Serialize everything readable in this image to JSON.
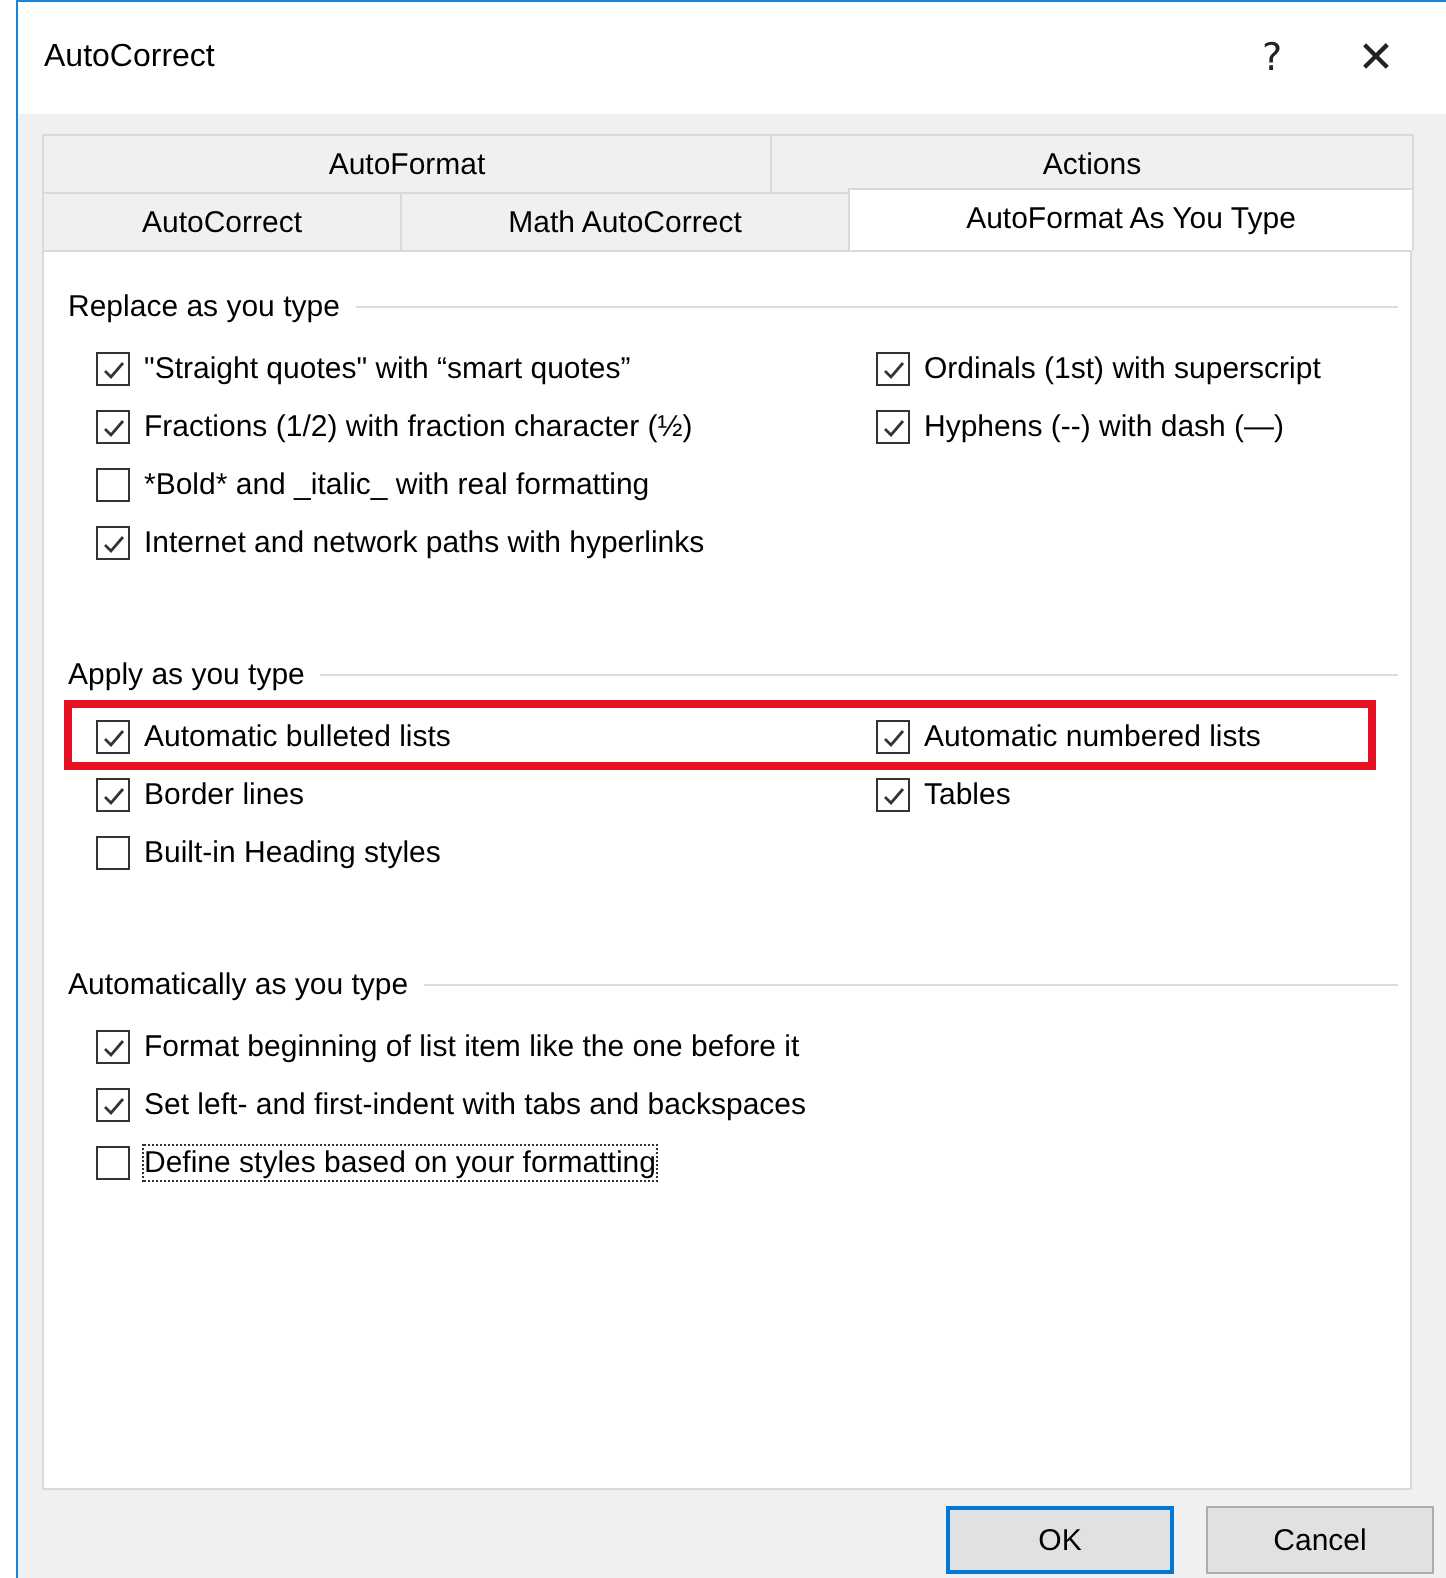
{
  "window": {
    "title": "AutoCorrect",
    "help": "?",
    "close": "✕"
  },
  "tab_rows": [
    [
      {
        "label": "AutoFormat",
        "selected": false
      },
      {
        "label": "Actions",
        "selected": false
      }
    ],
    [
      {
        "label": "AutoCorrect",
        "selected": false
      },
      {
        "label": "Math AutoCorrect",
        "selected": false
      },
      {
        "label": "AutoFormat As You Type",
        "selected": true
      }
    ]
  ],
  "sections": [
    {
      "title": "Replace as you type",
      "rows": [
        {
          "items": [
            {
              "label": "\"Straight quotes\" with “smart quotes”",
              "checked": true
            },
            {
              "label": "Ordinals (1st) with superscript",
              "checked": true
            }
          ]
        },
        {
          "items": [
            {
              "label": "Fractions (1/2) with fraction character (½)",
              "checked": true
            },
            {
              "label": "Hyphens (--) with dash (—)",
              "checked": true
            }
          ]
        },
        {
          "items": [
            {
              "label": "*Bold* and _italic_ with real formatting",
              "checked": false
            }
          ]
        },
        {
          "items": [
            {
              "label": "Internet and network paths with hyperlinks",
              "checked": true
            }
          ]
        }
      ]
    },
    {
      "title": "Apply as you type",
      "rows": [
        {
          "highlighted": true,
          "items": [
            {
              "label": "Automatic bulleted lists",
              "checked": true
            },
            {
              "label": "Automatic numbered lists",
              "checked": true
            }
          ]
        },
        {
          "items": [
            {
              "label": "Border lines",
              "checked": true
            },
            {
              "label": "Tables",
              "checked": true
            }
          ]
        },
        {
          "items": [
            {
              "label": "Built-in Heading styles",
              "checked": false
            }
          ]
        }
      ]
    },
    {
      "title": "Automatically as you type",
      "rows": [
        {
          "items": [
            {
              "label": "Format beginning of list item like the one before it",
              "checked": true,
              "focused": false
            }
          ]
        },
        {
          "items": [
            {
              "label": "Set left- and first-indent with tabs and backspaces",
              "checked": true,
              "focused": false
            }
          ]
        },
        {
          "items": [
            {
              "label": "Define styles based on your formatting",
              "checked": false,
              "focused": true
            }
          ]
        }
      ]
    }
  ],
  "buttons": [
    {
      "label": "OK",
      "default": true
    },
    {
      "label": "Cancel",
      "default": false
    }
  ]
}
